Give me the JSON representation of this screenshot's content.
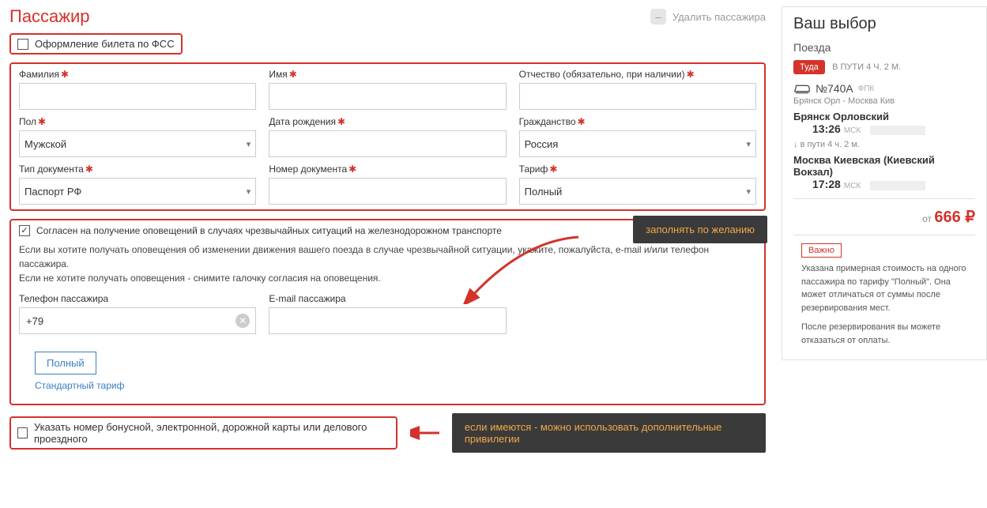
{
  "header": {
    "title": "Пассажир",
    "delete_label": "Удалить пассажира"
  },
  "fss": {
    "label": "Оформление билета по ФСС"
  },
  "fields": {
    "surname": {
      "label": "Фамилия"
    },
    "name": {
      "label": "Имя"
    },
    "patronymic": {
      "label": "Отчество (обязательно, при наличии)"
    },
    "gender": {
      "label": "Пол",
      "value": "Мужской"
    },
    "dob": {
      "label": "Дата рождения"
    },
    "citizenship": {
      "label": "Гражданство",
      "value": "Россия"
    },
    "doc_type": {
      "label": "Тип документа",
      "value": "Паспорт РФ"
    },
    "doc_number": {
      "label": "Номер документа"
    },
    "tariff": {
      "label": "Тариф",
      "value": "Полный"
    }
  },
  "notify": {
    "consent": "Согласен на получение оповещений в случаях чрезвычайных ситуаций на железнодорожном транспорте",
    "text1": "Если вы хотите получать оповещения об изменении движения вашего поезда в случае чрезвычайной ситуации, укажите, пожалуйста, e-mail и/или телефон пассажира.",
    "text2": "Если не хотите получать оповещения - снимите галочку согласия на оповещения.",
    "phone_label": "Телефон пассажира",
    "phone_value": "+79",
    "email_label": "E-mail пассажира",
    "tariff_btn": "Полный",
    "tariff_link": "Стандартный тариф"
  },
  "callout1": "заполнять по желанию",
  "bonus": {
    "label": "Указать номер бонусной, электронной, дорожной карты или делового проездного"
  },
  "callout2": "если имеются - можно использовать дополнительные привилегии",
  "choice": {
    "title": "Ваш выбор",
    "trains": "Поезда",
    "there": "Туда",
    "travel_time": "В ПУТИ 4 Ч. 2 М.",
    "train_no": "№740А",
    "fpc": "ФПК",
    "route_short": "Брянск Орл - Москва Кив",
    "station_from": "Брянск Орловский",
    "time_from": "13:26",
    "msk": "МСК",
    "in_way": "в пути  4 ч. 2 м.",
    "station_to": "Москва Киевская (Киевский Вокзал)",
    "time_to": "17:28",
    "price_from": "от",
    "price": "666 ₽",
    "important": "Важно",
    "note1": "Указана примерная стоимость на одного пассажира по тарифу \"Полный\". Она может отличаться от суммы после резервирования мест.",
    "note2": "После резервирования вы можете отказаться от оплаты."
  }
}
